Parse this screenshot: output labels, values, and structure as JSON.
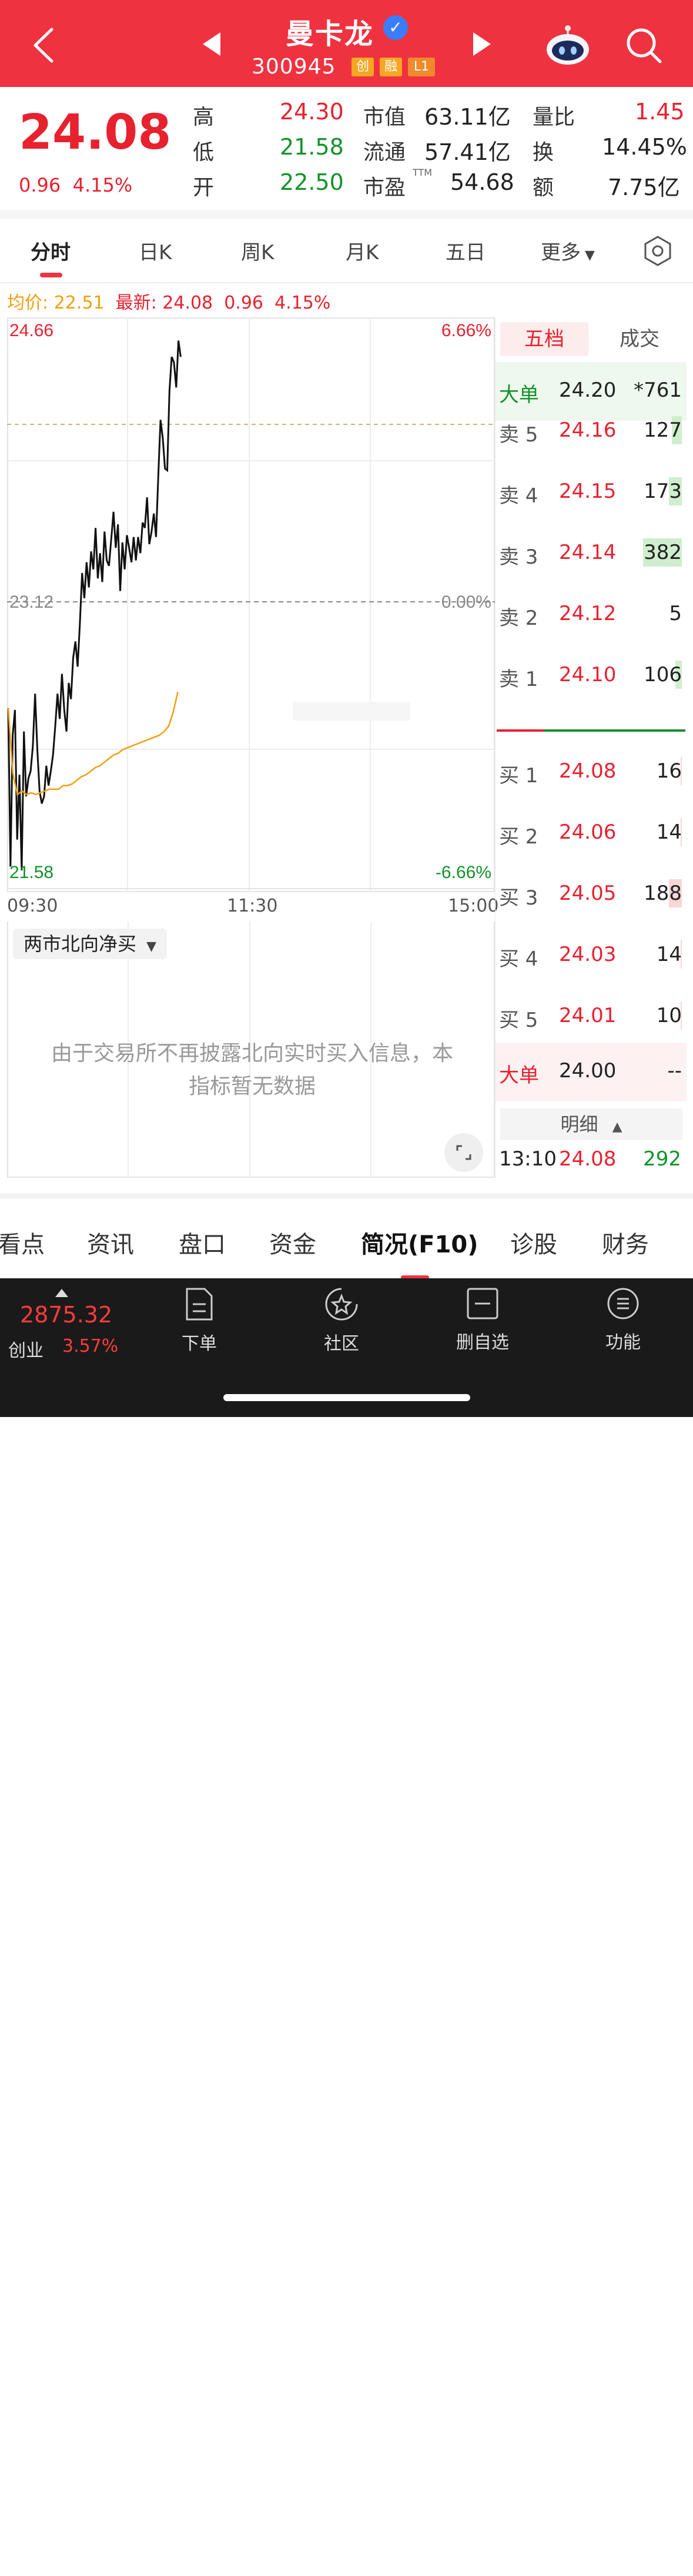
{
  "header": {
    "title": "曼卡龙",
    "code": "300945",
    "tags": [
      "创",
      "融",
      "L1"
    ]
  },
  "quote": {
    "price": "24.08",
    "change": "0.96",
    "change_pct": "4.15%",
    "stats": [
      {
        "label": "高",
        "value": "24.30",
        "color": "red"
      },
      {
        "label": "低",
        "value": "21.58",
        "color": "green"
      },
      {
        "label": "开",
        "value": "22.50",
        "color": "green"
      }
    ],
    "stats2": [
      {
        "label": "市值",
        "value": "63.11亿"
      },
      {
        "label": "流通",
        "value": "57.41亿"
      },
      {
        "label": "市盈",
        "sup": "TTM",
        "value": "54.68"
      }
    ],
    "stats3": [
      {
        "label": "量比",
        "value": "1.45",
        "color": "red"
      },
      {
        "label": "换",
        "value": "14.45%"
      },
      {
        "label": "额",
        "value": "7.75亿"
      }
    ]
  },
  "tabs": [
    "分时",
    "日K",
    "周K",
    "月K",
    "五日",
    "更多"
  ],
  "active_tab": "分时",
  "infoline": {
    "avg_label": "均价: 22.51",
    "latest_label": "最新: 24.08",
    "change": "0.96",
    "change_pct": "4.15%"
  },
  "chart_data": {
    "type": "line",
    "y_left_top": "24.66",
    "y_left_mid": "23.12",
    "y_left_bottom": "21.58",
    "y_right_top": "6.66%",
    "y_right_mid": "0.00%",
    "y_right_bottom": "-6.66%",
    "x_ticks": [
      "09:30",
      "11:30",
      "15:00"
    ],
    "ylim": [
      21.58,
      24.66
    ],
    "series": [
      {
        "values": [
          22.53,
          21.65,
          22.38,
          22.52,
          21.8,
          22.16,
          21.63,
          22.4,
          22.04,
          22.14,
          22.18,
          22.32,
          22.61,
          22.3,
          22.07,
          22.0,
          22.04,
          22.21,
          22.1,
          22.18,
          22.27,
          22.43,
          22.61,
          22.47,
          22.72,
          22.52,
          22.4,
          22.67,
          22.58,
          22.81,
          22.9,
          22.76,
          23.0,
          23.28,
          23.14,
          23.34,
          23.2,
          23.4,
          23.3,
          23.53,
          23.25,
          23.39,
          23.23,
          23.51,
          23.35,
          23.32,
          23.47,
          23.62,
          23.42,
          23.55,
          23.18,
          23.45,
          23.3,
          23.49,
          23.42,
          23.34,
          23.48,
          23.35,
          23.48,
          23.39,
          23.56,
          23.53,
          23.7,
          23.44,
          23.51,
          23.61,
          23.48,
          23.82,
          24.13,
          24.03,
          23.86,
          23.85,
          24.29,
          24.48,
          24.45,
          24.31,
          24.57,
          24.48
        ]
      },
      {
        "values": [
          22.53,
          22.17,
          22.05,
          22.07,
          22.05,
          22.06,
          22.05,
          22.06,
          22.07,
          22.08,
          22.08,
          22.08,
          22.1,
          22.1,
          22.11,
          22.13,
          22.15,
          22.16,
          22.18,
          22.2,
          22.21,
          22.23,
          22.25,
          22.27,
          22.28,
          22.3,
          22.31,
          22.32,
          22.33,
          22.34,
          22.35,
          22.36,
          22.37,
          22.38,
          22.4,
          22.43,
          22.51,
          22.62
        ]
      }
    ]
  },
  "orderbook": {
    "tabs": [
      "五档",
      "成交"
    ],
    "big_sell": {
      "label": "大单",
      "price": "24.20",
      "vol": "*761"
    },
    "asks": [
      {
        "label": "卖 5",
        "price": "24.16",
        "vol": "127",
        "bar": 0.15
      },
      {
        "label": "卖 4",
        "price": "24.15",
        "vol": "173",
        "bar": 0.2
      },
      {
        "label": "卖 3",
        "price": "24.14",
        "vol": "382",
        "bar": 0.6
      },
      {
        "label": "卖 2",
        "price": "24.12",
        "vol": "5",
        "bar": 0
      },
      {
        "label": "卖 1",
        "price": "24.10",
        "vol": "106",
        "bar": 0.1
      }
    ],
    "bids": [
      {
        "label": "买 1",
        "price": "24.08",
        "vol": "16",
        "bar": 0.02
      },
      {
        "label": "买 2",
        "price": "24.06",
        "vol": "14",
        "bar": 0.02
      },
      {
        "label": "买 3",
        "price": "24.05",
        "vol": "188",
        "bar": 0.2
      },
      {
        "label": "买 4",
        "price": "24.03",
        "vol": "14",
        "bar": 0.02
      },
      {
        "label": "买 5",
        "price": "24.01",
        "vol": "10",
        "bar": 0.02
      }
    ],
    "big_buy": {
      "label": "大单",
      "price": "24.00",
      "vol": "--"
    },
    "detail_label": "明细",
    "last_trade": {
      "time": "13:10",
      "price": "24.08",
      "vol": "292"
    }
  },
  "northbound": {
    "select_label": "两市北向净买",
    "message_line1": "由于交易所不再披露北向实时买入信息，本",
    "message_line2": "指标暂无数据"
  },
  "bottom_tabs": [
    "看点",
    "资讯",
    "盘口",
    "资金",
    "简况(F10)",
    "诊股",
    "财务"
  ],
  "active_bottom_tab": "简况(F10)",
  "nav": {
    "index_value": "2875.32",
    "index_name": "创业",
    "index_pct": "3.57%",
    "items": [
      "下单",
      "社区",
      "删自选",
      "功能"
    ]
  }
}
